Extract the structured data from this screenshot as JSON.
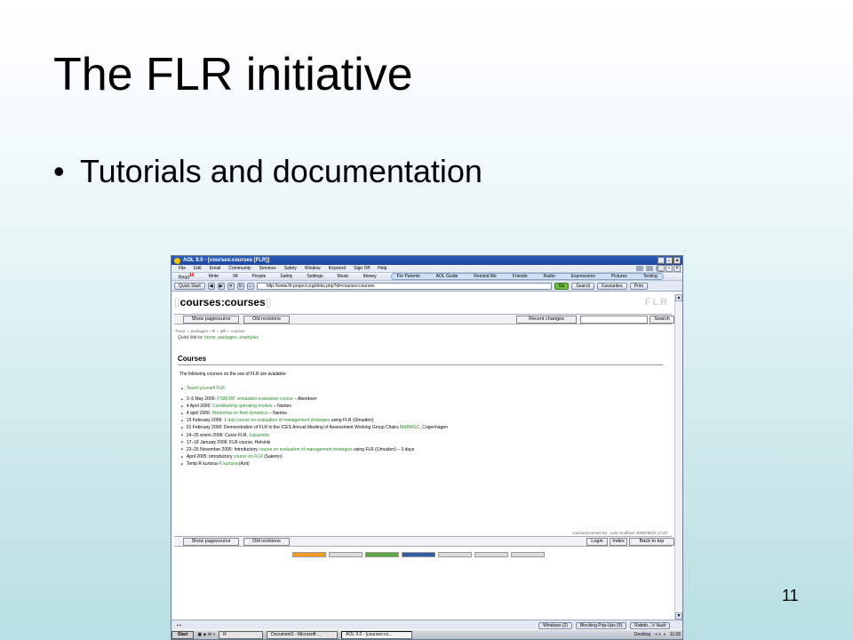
{
  "slide": {
    "title": "The FLR initiative",
    "bullet": "Tutorials and documentation",
    "number": "11"
  },
  "browser": {
    "window_title": "AOL 9.0 - [courses:courses [FLR]]",
    "menu": [
      "File",
      "Edit",
      "Email",
      "Community",
      "Services",
      "Safety",
      "Window",
      "Keyword",
      "Sign Off",
      "Help"
    ],
    "toolbar": {
      "read": "Read",
      "read_count": "10",
      "items": [
        "Write",
        "IM",
        "People",
        "Safety",
        "Settings",
        "Music",
        "Money"
      ],
      "pill_items": [
        "For Parents",
        "AOL Guide",
        "Remind Me",
        "Friends",
        "Radio",
        "Expressions",
        "Pictures",
        "Texting"
      ]
    },
    "quick_start": "Quick Start",
    "url": "http://www.flr-project.org/doku.php?id=courses:courses",
    "go": "Go",
    "search": "Search",
    "favourites": "Favourites",
    "print": "Print"
  },
  "wiki": {
    "title_open": "[[",
    "title": "courses:courses",
    "title_close": "]]",
    "logo": "FLR",
    "show_pagesource": "Show pagesource",
    "old_revisions": "Old revisions",
    "recent_changes": "Recent changes",
    "search": "Search",
    "trace": "Trace: » packages » flr » tyflr » courses",
    "quick_label": "Quick link to:",
    "quick_links": "home, packages, examples",
    "heading": "Courses",
    "intro": "The following courses on the use of FLR are available:",
    "teach": "Teach yourself FLR",
    "courses": [
      {
        "pre": "2–5 May 2006: ",
        "link": "FISBOAT simulation evaluation course",
        "post": " – Aberdeen"
      },
      {
        "pre": "4 April 2006: ",
        "link": "Conditioning operating models",
        "post": " – Nantes"
      },
      {
        "pre": "4 april 2006: ",
        "link": "Workshop on fleet dynamics",
        "post": " – Nantes"
      },
      {
        "pre": "15 February 2006: ",
        "link": "1-day course on evaluation of management strategies",
        "post": " using FLR (IJmuiden)"
      },
      {
        "pre": "01 February 2006: Demonstration of FLR to the ICES Annual Meeting of Assessment Working Group Chairs ",
        "link": "AMAWGC",
        "post": ", Copenhagen"
      },
      {
        "pre": "24–25 enero 2006: Curso FLR, ",
        "link": "Sukarrieta",
        "post": ""
      },
      {
        "pre": "17–18 January 2006: FLR course, Helsinki",
        "link": "",
        "post": ""
      },
      {
        "pre": "23–25 November 2005: Introductory ",
        "link": "course on evaluation of management strategies",
        "post": " using FLR (IJmuiden) – 3 days"
      },
      {
        "pre": "April 2005: Introductory ",
        "link": "course on FLR",
        "post": " (Salerno)"
      },
      {
        "pre": "Temp R kurtsoa ",
        "link": "R kurtsoa",
        "post": " (Azti)"
      }
    ],
    "last_modified": "courses/courses.txt · Last modified: 2006/06/20 13:20",
    "login": "Login",
    "index": "Index",
    "back_to_top": "Back to top"
  },
  "statusbar": {
    "windows": "Windows (2)",
    "popups": "Blocking Pop-Ups (0)",
    "vault": "Rabdo...'s Vault"
  },
  "taskbar": {
    "start": "Start",
    "r": "R",
    "task1": "Document1 - Microsoft ...",
    "task2": "AOL 9.0 - [courses:co...",
    "desktop": "Desktop",
    "clock": "11:58"
  }
}
